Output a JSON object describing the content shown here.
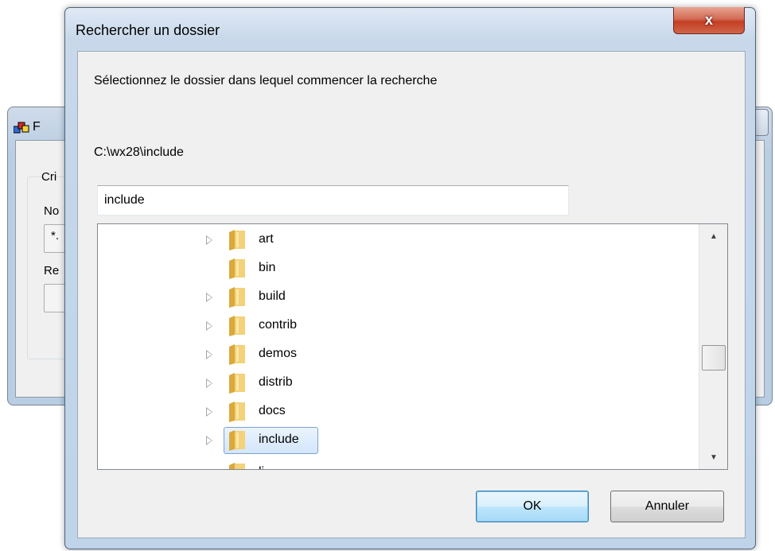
{
  "background_window": {
    "title_fragment": "F",
    "group_label": "Cri",
    "field_label_1": "No",
    "field_value_1": "*.",
    "field_label_2": "Re"
  },
  "dialog": {
    "title": "Rechercher un dossier",
    "close_symbol": "x",
    "instruction": "Sélectionnez le dossier dans lequel commencer la recherche",
    "current_path": "C:\\wx28\\include",
    "folder_input_value": "include"
  },
  "tree": {
    "items": [
      {
        "label": "art",
        "expandable": true
      },
      {
        "label": "bin",
        "expandable": false
      },
      {
        "label": "build",
        "expandable": true
      },
      {
        "label": "contrib",
        "expandable": true
      },
      {
        "label": "demos",
        "expandable": true
      },
      {
        "label": "distrib",
        "expandable": true
      },
      {
        "label": "docs",
        "expandable": true
      },
      {
        "label": "include",
        "expandable": true,
        "selected": true
      }
    ],
    "partial_item_label": "li"
  },
  "buttons": {
    "ok_label": "OK",
    "cancel_label": "Annuler"
  },
  "colors": {
    "selection_border": "#7da2ce",
    "close_button": "#c43f23",
    "folder": "#e6b84a"
  }
}
